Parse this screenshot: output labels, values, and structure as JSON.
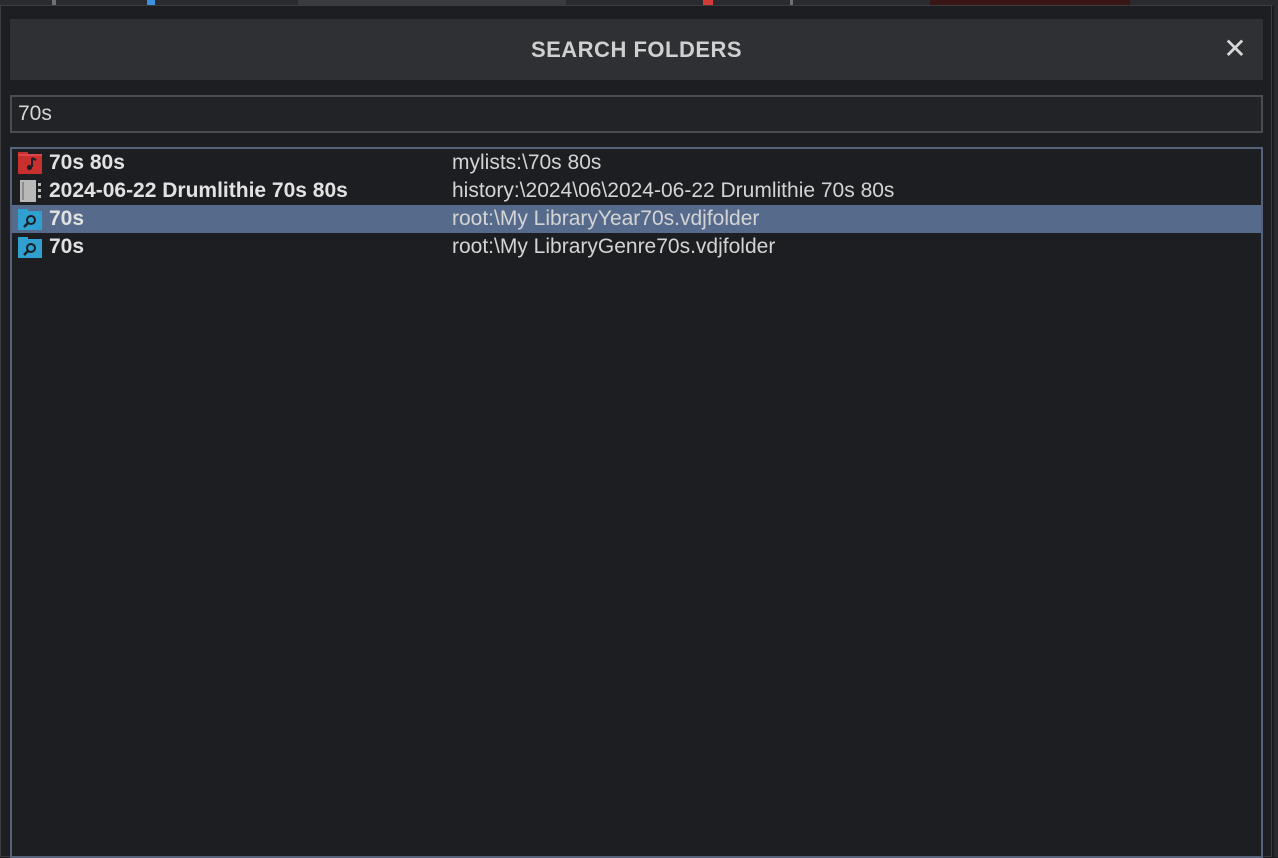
{
  "dialog": {
    "title": "SEARCH FOLDERS",
    "close_label": "✕"
  },
  "search": {
    "value": "70s",
    "placeholder": ""
  },
  "results": [
    {
      "name": "70s 80s",
      "path": "mylists:\\70s 80s",
      "icon": "playlist-icon",
      "selected": false
    },
    {
      "name": "2024-06-22 Drumlithie 70s 80s",
      "path": "history:\\2024\\06\\2024-06-22 Drumlithie 70s 80s",
      "icon": "history-icon",
      "selected": false
    },
    {
      "name": "70s",
      "path": "root:\\My LibraryYear70s.vdjfolder",
      "icon": "filter-folder-icon",
      "selected": true
    },
    {
      "name": "70s",
      "path": "root:\\My LibraryGenre70s.vdjfolder",
      "icon": "filter-folder-icon",
      "selected": false
    }
  ],
  "colors": {
    "selection": "#566b8c",
    "playlist_icon": "#d33a3a",
    "filter_folder_icon": "#2fa0d0"
  }
}
